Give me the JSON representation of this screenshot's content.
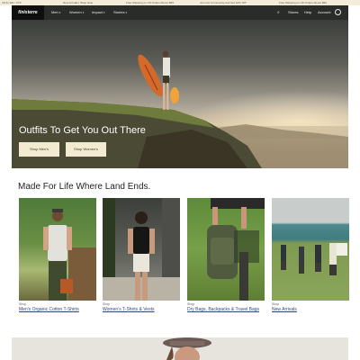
{
  "promo_bar": {
    "left_text": "US $ / EN / UTF",
    "center_left": "New Arrivals | Shop Now",
    "center": "Free Shipping on US Orders Above $99",
    "center_right": "Join Our Community And Get 10% Off*",
    "right": "Free Shipping on US Orders Above $99"
  },
  "nav": {
    "logo": "finisterre",
    "items": [
      {
        "label": "Men"
      },
      {
        "label": "Women"
      },
      {
        "label": "Impact"
      },
      {
        "label": "Stories"
      }
    ],
    "right_links": [
      "Stores",
      "Help",
      "Account"
    ]
  },
  "hero": {
    "title": "Outfits To Get You Out There",
    "buttons": [
      "Shop Men's",
      "Shop Women's"
    ]
  },
  "section": {
    "title": "Made For Life Where Land Ends."
  },
  "cards": [
    {
      "category": "Shop",
      "link": "Men's Organic Cotton T-Shirts"
    },
    {
      "category": "Shop",
      "link": "Women's T-Shirts & Vests"
    },
    {
      "category": "Shop",
      "link": "Dry Bags, Backpacks & Travel Bags"
    },
    {
      "category": "Shop",
      "link": "New Arrivals"
    }
  ]
}
